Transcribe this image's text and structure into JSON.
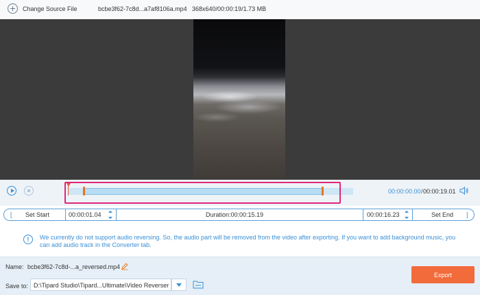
{
  "topbar": {
    "change_source_label": "Change Source File",
    "file_name": "bcbe3f62-7c8d...a7af8106a.mp4",
    "file_info": "368x640/00:00:19/1.73 MB"
  },
  "playback": {
    "current_time": "00:00:00.00",
    "separator": "/",
    "total_time": "00:00:19.01"
  },
  "trim": {
    "bracket_left": "[",
    "set_start_label": "Set Start",
    "start_time": "00:00:01.04",
    "duration_text": "Duration:00:00:15.19",
    "end_time": "00:00:16.23",
    "set_end_label": "Set End",
    "bracket_right": "]"
  },
  "notice": {
    "icon_text": "!",
    "line1": "We currently do not support audio reversing. So, the audio part will be removed from the video after exporting. If you want to add background music, you",
    "line2": "can add audio track in the Converter tab."
  },
  "output": {
    "name_label": "Name:",
    "name_value": "bcbe3f62-7c8d-...a_reversed.mp4",
    "save_to_label": "Save to:",
    "save_path": "D:\\Tipard Studio\\Tipard...Ultimate\\Video Reverser",
    "export_label": "Export"
  },
  "colors": {
    "accent": "#3a8fd6",
    "export": "#f26b3a",
    "highlight": "#e2257a"
  }
}
